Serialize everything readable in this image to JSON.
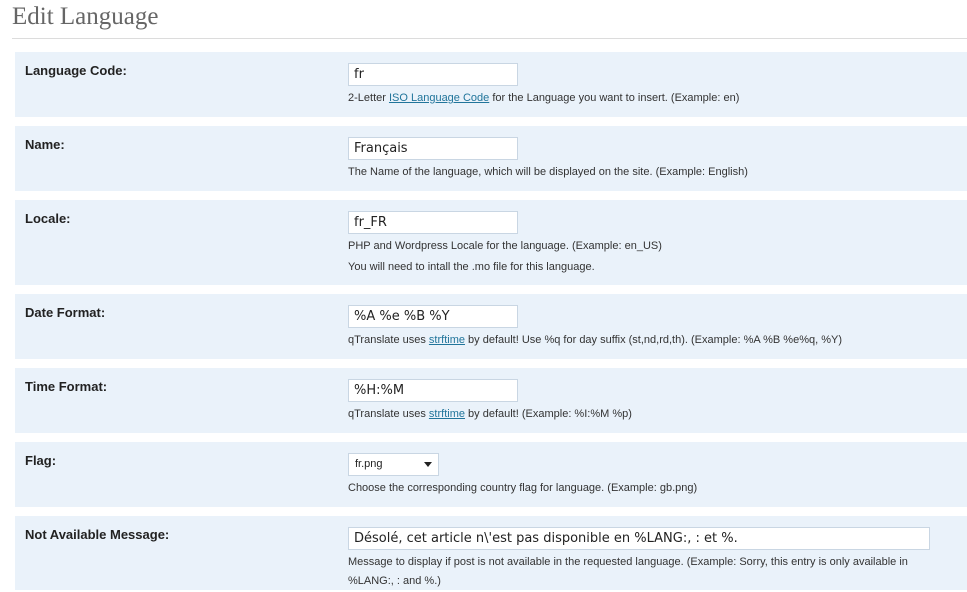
{
  "page": {
    "title": "Edit Language"
  },
  "fields": {
    "language_code": {
      "label": "Language Code:",
      "value": "fr",
      "desc_before": "2-Letter ",
      "desc_link": "ISO Language Code",
      "desc_after": " for the Language you want to insert. (Example: en)"
    },
    "name": {
      "label": "Name:",
      "value": "Français",
      "desc": "The Name of the language, which will be displayed on the site. (Example: English)"
    },
    "locale": {
      "label": "Locale:",
      "value": "fr_FR",
      "desc1": "PHP and Wordpress Locale for the language. (Example: en_US)",
      "desc2": "You will need to intall the .mo file for this language."
    },
    "date_format": {
      "label": "Date Format:",
      "value": "%A %e %B %Y",
      "desc_before": "qTranslate uses ",
      "desc_link": "strftime",
      "desc_after": " by default! Use %q for day suffix (st,nd,rd,th). (Example: %A %B %e%q, %Y)"
    },
    "time_format": {
      "label": "Time Format:",
      "value": "%H:%M",
      "desc_before": "qTranslate uses ",
      "desc_link": "strftime",
      "desc_after": " by default! (Example: %I:%M %p)"
    },
    "flag": {
      "label": "Flag:",
      "selected": "fr.png",
      "desc": "Choose the corresponding country flag for language. (Example: gb.png)"
    },
    "not_available": {
      "label": "Not Available Message:",
      "value": "Désolé, cet article n\\'est pas disponible en %LANG:, : et %.",
      "desc1": "Message to display if post is not available in the requested language. (Example: Sorry, this entry is only available in",
      "desc2": "%LANG:, : and %.)"
    }
  },
  "colors": {
    "row_bg": "#eaf2fa",
    "link": "#21759b",
    "title": "#666666"
  }
}
